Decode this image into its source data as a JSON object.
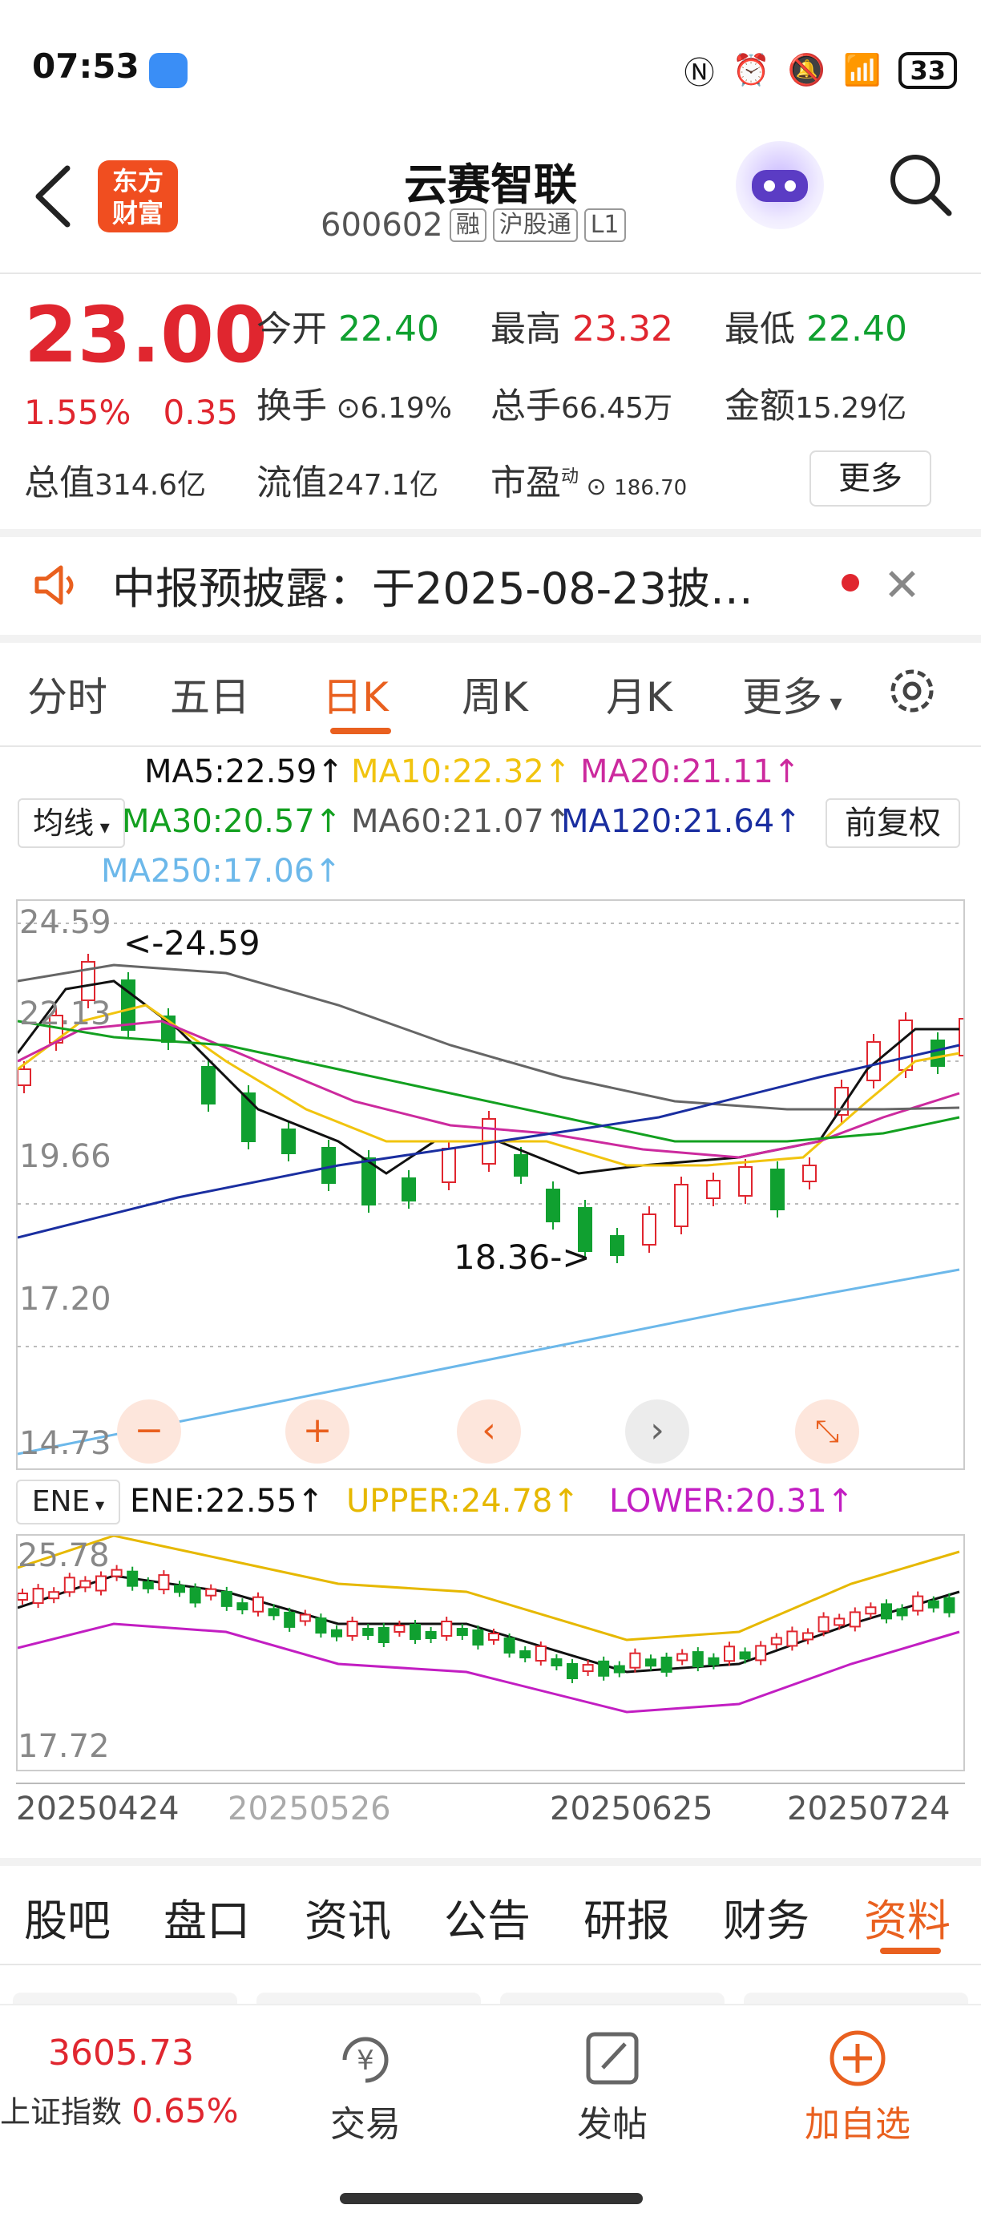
{
  "status": {
    "time": "07:53",
    "battery": "33"
  },
  "header": {
    "logo_line1": "东方",
    "logo_line2": "财富",
    "name": "云赛智联",
    "code": "600602",
    "tags": [
      "融",
      "沪股通",
      "L1"
    ]
  },
  "quote": {
    "price": "23.00",
    "change_pct": "1.55%",
    "change": "0.35",
    "open_label": "今开",
    "open": "22.40",
    "high_label": "最高",
    "high": "23.32",
    "low_label": "最低",
    "low": "22.40",
    "turnover_label": "换手",
    "turnover": "6.19%",
    "volume_label": "总手",
    "volume": "66.45万",
    "amount_label": "金额",
    "amount": "15.29亿",
    "mktcap_label": "总值",
    "mktcap": "314.6亿",
    "float_label": "流值",
    "float": "247.1亿",
    "pe_label": "市盈",
    "pe_sup": "动",
    "pe": "186.70",
    "more": "更多"
  },
  "notice": {
    "text": "中报预披露：于2025-08-23披…"
  },
  "tabs": {
    "items": [
      "分时",
      "五日",
      "日K",
      "周K",
      "月K",
      "更多"
    ],
    "active": "日K"
  },
  "indicators": {
    "ma5": "MA5:22.59↑",
    "ma10": "MA10:22.32↑",
    "ma20": "MA20:21.11↑",
    "selector": "均线",
    "ma30": "MA30:20.57↑",
    "ma60": "MA60:21.07↑",
    "ma120": "MA120:21.64↑",
    "adjust": "前复权",
    "ma250": "MA250:17.06↑"
  },
  "main_chart": {
    "ylabels": [
      "24.59",
      "22.13",
      "19.66",
      "17.20",
      "14.73"
    ],
    "high_note": "<-24.59",
    "low_note": "18.36->"
  },
  "ene": {
    "selector": "ENE",
    "ene": "ENE:22.55↑",
    "upper": "UPPER:24.78↑",
    "lower": "LOWER:20.31↑",
    "ylabels": [
      "25.78",
      "17.72"
    ]
  },
  "dates": [
    "20250424",
    "20250526",
    "20250625",
    "20250724"
  ],
  "bottom_tabs": {
    "items": [
      "股吧",
      "盘口",
      "资讯",
      "公告",
      "研报",
      "财务",
      "资料"
    ],
    "active": "资料"
  },
  "bottom_bar": {
    "index_value": "3605.73",
    "index_name": "上证指数",
    "index_pct": "0.65%",
    "trade": "交易",
    "post": "发帖",
    "watch": "加自选"
  },
  "colors": {
    "up": "#e0262f",
    "down": "#10a030",
    "accent": "#e9601f",
    "ma5": "#111111",
    "ma10": "#f1c40f",
    "ma20": "#cc2a9e",
    "ma30": "#13a020",
    "ma60": "#666666",
    "ma120": "#1a2ea0",
    "ma250": "#6cb8ea"
  }
}
